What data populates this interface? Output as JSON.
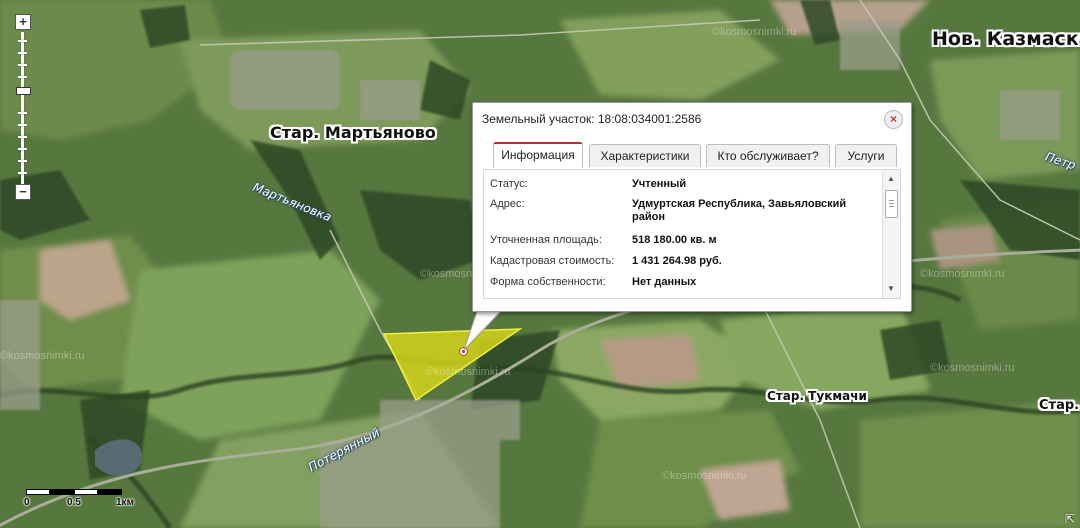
{
  "map": {
    "places": {
      "nov_kazmaska": "Нов. Казмаска",
      "star_martyanovo": "Стар. Мартьяново",
      "star_tukmachi": "Стар. Тукмачи",
      "star_cut": "Стар. К",
      "petr_cut": "Петр"
    },
    "rivers": {
      "martyanovka": "Мартьяновка",
      "poteryanny": "Потерянный"
    },
    "watermark": "©kosmosnimki.ru"
  },
  "zoom": {
    "plus": "+",
    "minus": "−",
    "level_fraction": 0.38
  },
  "scale": {
    "label_0": "0",
    "label_mid": "0.5",
    "label_end": "1км"
  },
  "popup": {
    "title": "Земельный участок: 18:08:034001:2586",
    "close": "×",
    "tabs": [
      {
        "label": "Информация",
        "active": true
      },
      {
        "label": "Характеристики",
        "active": false
      },
      {
        "label": "Кто обслуживает?",
        "active": false
      },
      {
        "label": "Услуги",
        "active": false
      }
    ],
    "rows": [
      {
        "label": "Статус:",
        "value": "Учтенный"
      },
      {
        "label": "Адрес:",
        "value": "Удмуртская Республика, Завьяловский район"
      },
      {
        "label": "Уточненная площадь:",
        "value": "518 180.00 кв. м"
      },
      {
        "label": "Кадастровая стоимость:",
        "value": "1 431 264.98 руб."
      },
      {
        "label": "Форма собственности:",
        "value": "Нет данных"
      }
    ]
  },
  "colors": {
    "parcel_fill": "#d4d21a",
    "tab_accent": "#b0302a",
    "marker": "#c0392b"
  },
  "icons": {
    "close": "close-icon",
    "resize": "resize-icon",
    "marker": "map-marker-icon"
  }
}
